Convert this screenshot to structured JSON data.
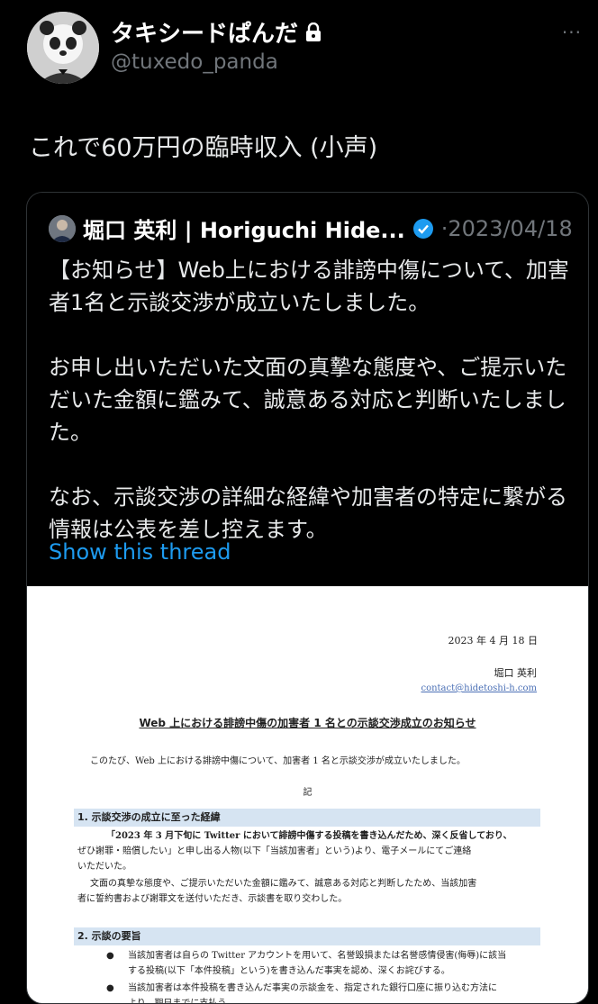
{
  "header": {
    "display_name": "タキシードぱんだ",
    "handle": "@tuxedo_panda",
    "more": "···"
  },
  "tweet": {
    "text": "これで60万円の臨時収入 (小声)"
  },
  "quote": {
    "name": "堀口 英利 | Horiguchi Hide...",
    "date": "·2023/04/18",
    "paragraphs": [
      "【お知らせ】Web上における誹謗中傷について、加害者1名と示談交渉が成立いたしました。",
      "お申し出いただいた文面の真摯な態度や、ご提示いただいた金額に鑑みて、誠意ある対応と判断いたしました。",
      "なお、示談交渉の詳細な経緯や加害者の特定に繋がる情報は公表を差し控えます。"
    ],
    "show_thread": "Show this thread"
  },
  "document": {
    "date": "2023 年 4 月 18 日",
    "author": "堀口 英利",
    "email": "contact@hidetoshi-h.com",
    "title": "Web 上における誹謗中傷の加害者 1 名との示談交渉成立のお知らせ",
    "intro": "このたび、Web 上における誹謗中傷について、加害者 1 名と示談交渉が成立いたしました。",
    "ki": "記",
    "section1": {
      "heading": "1.  示談交渉の成立に至った経緯",
      "line1": "「2023 年 3 月下旬に Twitter において誹謗中傷する投稿を書き込んだため、深く反省しており、",
      "line2": "ぜひ謝罪・賠償したい」と申し出る人物(以下「当該加害者」という)より、電子メールにてご連絡",
      "line3": "いただいた。",
      "line4": "文面の真摯な態度や、ご提示いただいた金額に鑑みて、誠意ある対応と判断したため、当該加害",
      "line5": "者に誓約書および謝罪文を送付いただき、示談書を取り交わした。"
    },
    "section2": {
      "heading": "2.  示談の要旨",
      "bullet1_line1": "当該加害者は自らの Twitter アカウントを用いて、名誉毀損または名誉感情侵害(侮辱)に該当",
      "bullet1_line2": "する投稿(以下「本件投稿」という)を書き込んだ事実を認め、深くお詫びする。",
      "bullet2_line1": "当該加害者は本件投稿を書き込んだ事実の示談金を、指定された銀行口座に振り込む方法に",
      "bullet2_line2": "より、期日までに支払う。",
      "bullet_symbol": "●"
    }
  },
  "colors": {
    "background": "#000000",
    "link": "#1d9bf0",
    "verified": "#1d9bf0",
    "section_bar": "#d6e4f2"
  }
}
